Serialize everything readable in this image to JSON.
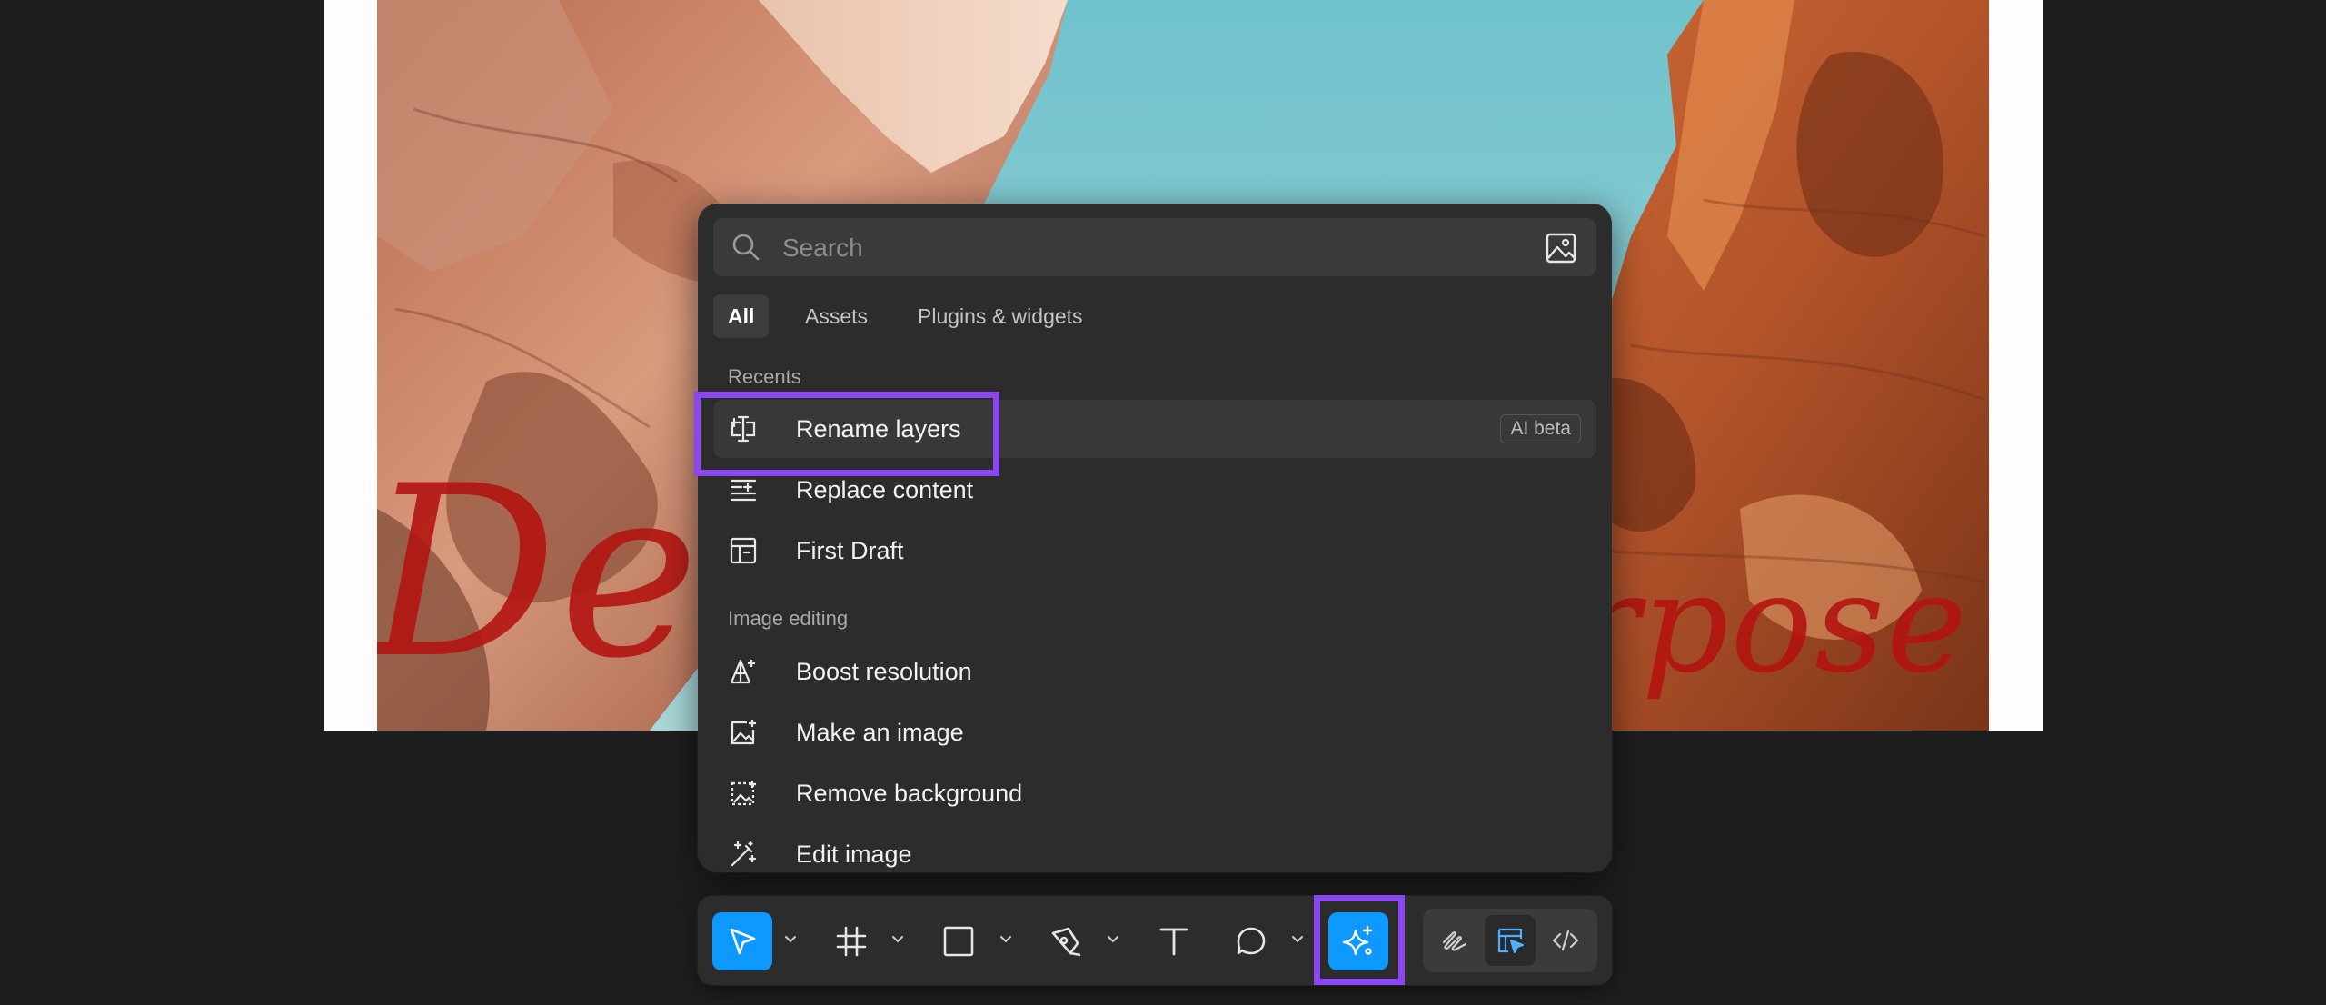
{
  "search": {
    "placeholder": "Search"
  },
  "tabs": [
    {
      "label": "All",
      "active": true
    },
    {
      "label": "Assets",
      "active": false
    },
    {
      "label": "Plugins & widgets",
      "active": false
    }
  ],
  "sections": {
    "recents": {
      "label": "Recents",
      "items": [
        {
          "label": "Rename layers",
          "icon": "rename-layers-icon",
          "badge": "AI beta"
        },
        {
          "label": "Replace content",
          "icon": "replace-content-icon"
        },
        {
          "label": "First Draft",
          "icon": "first-draft-icon"
        }
      ]
    },
    "image_editing": {
      "label": "Image editing",
      "items": [
        {
          "label": "Boost resolution",
          "icon": "boost-resolution-icon"
        },
        {
          "label": "Make an image",
          "icon": "make-image-icon"
        },
        {
          "label": "Remove background",
          "icon": "remove-background-icon"
        },
        {
          "label": "Edit image",
          "icon": "edit-image-icon"
        }
      ]
    }
  },
  "artwork": {
    "word_left": "De",
    "word_right": "rpose"
  },
  "toolbar": {
    "tools": [
      "move-tool",
      "frame-tool",
      "shape-tool",
      "pen-tool",
      "text-tool",
      "comment-tool",
      "actions-ai-tool"
    ],
    "modes": [
      "draw-mode",
      "design-mode",
      "dev-mode"
    ]
  },
  "colors": {
    "accent": "#0d99ff",
    "highlight": "#8c46f0",
    "panel": "#2c2c2c",
    "canvas": "#1e1e1e"
  }
}
